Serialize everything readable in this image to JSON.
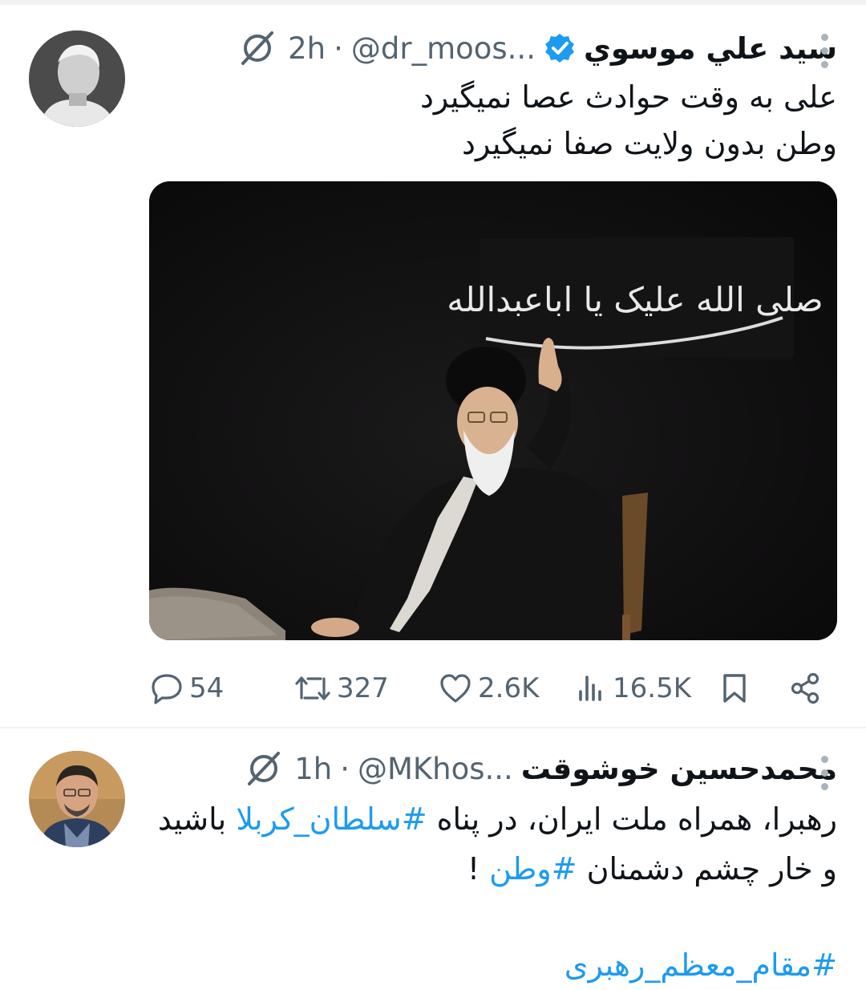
{
  "tweets": [
    {
      "display_name": "سيد علي موسوي",
      "handle": "@dr_moos...",
      "separator": "·",
      "time": "2h",
      "verified": true,
      "lines": [
        "على به وقت حوادث عصا نميگيرد",
        "وطن بدون ولايت صفا نميگيرد"
      ],
      "media": {
        "banner_text": "صلی الله علیک یا اباعبدالله"
      },
      "stats": {
        "replies": "54",
        "retweets": "327",
        "likes": "2.6K",
        "views": "16.5K"
      }
    },
    {
      "display_name": "محمدحسين خوشوقت",
      "handle": "@MKhos...",
      "separator": "·",
      "time": "1h",
      "line1": {
        "before": "رهبرا، همراه ملت ایران، در پناه ",
        "hashtag": "#سلطان_کربلا",
        "after": " باشید"
      },
      "line2": {
        "before": "و خار چشم دشمنان ",
        "hashtag": "#وطن",
        "after": " !"
      },
      "line3": {
        "hashtag": "#مقام_معظم_رهبری"
      }
    }
  ],
  "colors": {
    "accent": "#1d9bf0",
    "muted": "#536471",
    "text": "#0f1419"
  }
}
